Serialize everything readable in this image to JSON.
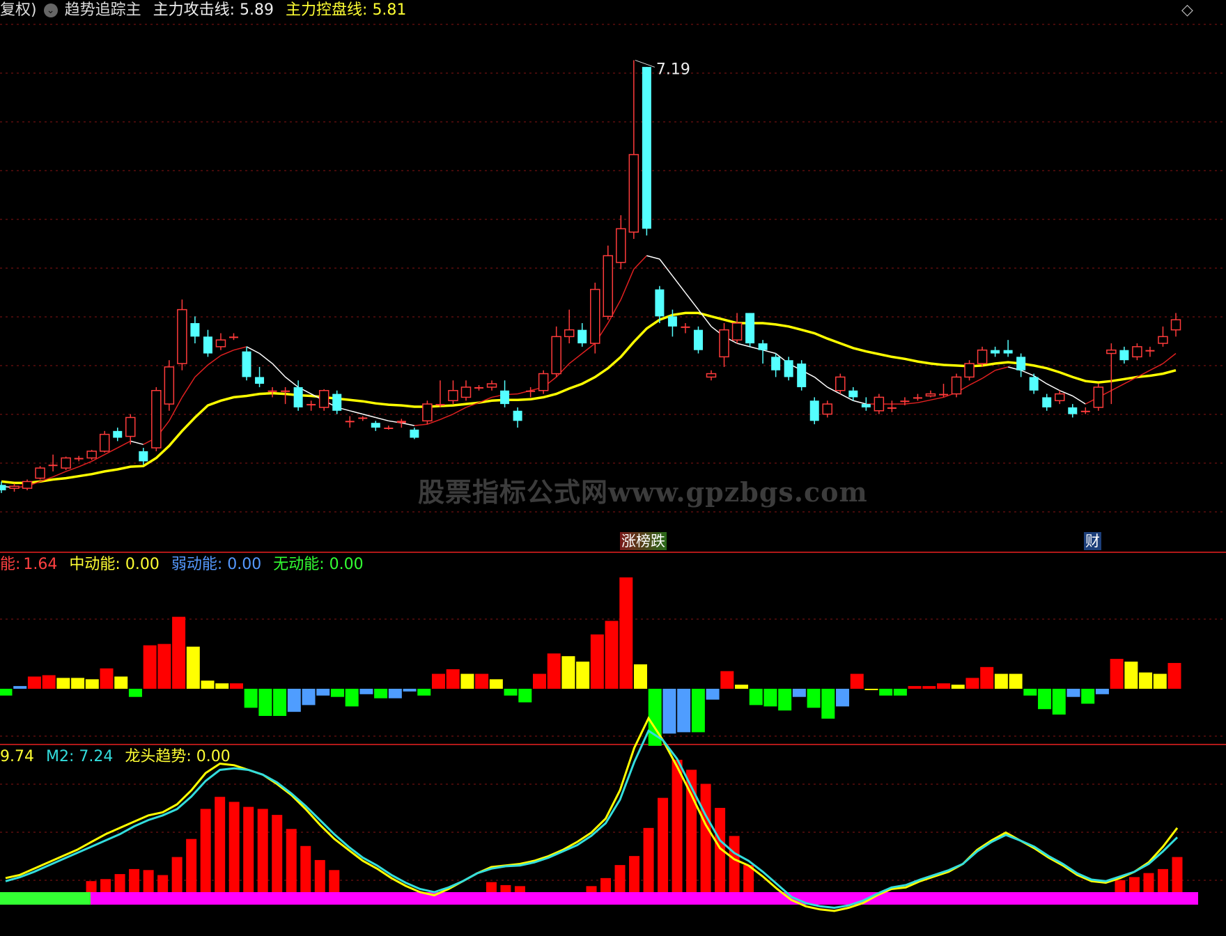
{
  "header_main": {
    "prefix": "复权)",
    "indicator": "趋势追踪主",
    "attack_label": "主力攻击线:",
    "attack_value": "5.89",
    "control_label": "主力控盘线:",
    "control_value": "5.81"
  },
  "header_energy": {
    "strong_label": "能:",
    "strong_value": "1.64",
    "mid_label": "中动能:",
    "mid_value": "0.00",
    "weak_label": "弱动能:",
    "weak_value": "0.00",
    "none_label": "无动能:",
    "none_value": "0.00"
  },
  "header_trend": {
    "m1_value": "9.74",
    "m2_label": "M2:",
    "m2_value": "7.24",
    "dragon_label": "龙头趋势:",
    "dragon_value": "0.00"
  },
  "peak_label": "7.19",
  "badges": {
    "limit": "涨榜跌",
    "finance": "财"
  },
  "watermark": "股票指标公式网www.gpzbgs.com",
  "icons": {
    "expand": "diamond-icon",
    "menu": "circle-chevron-icon"
  },
  "colors": {
    "up": "#ff3b3b",
    "down": "#54ffff",
    "ma_fast": "#ffffff",
    "ma_slow": "#ffff00",
    "red": "#ff0000",
    "yellow": "#ffff00",
    "green": "#00ff00",
    "blue": "#4f9dff",
    "magenta": "#ff00ff",
    "cyan": "#33dddd"
  },
  "chart_data": {
    "type": "candlestick",
    "candles": [
      [
        4.9,
        4.82,
        4.95,
        4.78
      ],
      [
        4.85,
        4.88,
        4.92,
        4.8
      ],
      [
        4.85,
        4.95,
        4.98,
        4.82
      ],
      [
        5.0,
        5.15,
        5.18,
        4.98
      ],
      [
        5.2,
        5.2,
        5.35,
        5.1
      ],
      [
        5.15,
        5.3,
        5.32,
        5.12
      ],
      [
        5.28,
        5.3,
        5.33,
        5.25
      ],
      [
        5.3,
        5.4,
        5.42,
        5.27
      ],
      [
        5.4,
        5.65,
        5.7,
        5.38
      ],
      [
        5.7,
        5.6,
        5.75,
        5.55
      ],
      [
        5.62,
        5.9,
        5.95,
        5.5
      ],
      [
        5.4,
        5.25,
        5.45,
        5.2
      ],
      [
        5.45,
        6.3,
        6.35,
        5.4
      ],
      [
        6.1,
        6.65,
        6.75,
        6.0
      ],
      [
        6.7,
        7.5,
        7.65,
        6.6
      ],
      [
        7.3,
        7.1,
        7.4,
        7.0
      ],
      [
        7.1,
        6.85,
        7.2,
        6.8
      ],
      [
        6.95,
        7.05,
        7.15,
        6.9
      ],
      [
        7.1,
        7.1,
        7.15,
        7.05
      ],
      [
        6.88,
        6.5,
        6.95,
        6.45
      ],
      [
        6.5,
        6.4,
        6.65,
        6.35
      ],
      [
        6.3,
        6.3,
        6.35,
        6.2
      ],
      [
        6.3,
        6.3,
        6.35,
        6.1
      ],
      [
        6.35,
        6.05,
        6.45,
        6.0
      ],
      [
        6.1,
        6.1,
        6.15,
        6.0
      ],
      [
        6.05,
        6.3,
        6.32,
        6.0
      ],
      [
        6.25,
        6.0,
        6.3,
        5.95
      ],
      [
        5.85,
        5.85,
        5.92,
        5.75
      ],
      [
        5.88,
        5.9,
        5.92,
        5.85
      ],
      [
        5.82,
        5.75,
        5.85,
        5.7
      ],
      [
        5.75,
        5.75,
        5.78,
        5.72
      ],
      [
        5.82,
        5.85,
        5.88,
        5.75
      ],
      [
        5.72,
        5.6,
        5.75,
        5.58
      ],
      [
        5.85,
        6.1,
        6.15,
        5.8
      ],
      [
        6.1,
        6.1,
        6.45,
        6.05
      ],
      [
        6.15,
        6.3,
        6.45,
        6.1
      ],
      [
        6.2,
        6.35,
        6.45,
        6.15
      ],
      [
        6.35,
        6.35,
        6.38,
        6.3
      ],
      [
        6.35,
        6.4,
        6.45,
        6.3
      ],
      [
        6.3,
        6.1,
        6.45,
        6.05
      ],
      [
        6.0,
        5.85,
        6.05,
        5.75
      ],
      [
        6.3,
        6.3,
        6.35,
        6.2
      ],
      [
        6.3,
        6.55,
        6.6,
        6.25
      ],
      [
        6.55,
        7.1,
        7.25,
        6.5
      ],
      [
        7.1,
        7.2,
        7.5,
        7.0
      ],
      [
        7.2,
        7.0,
        7.3,
        6.95
      ],
      [
        7.0,
        7.8,
        7.9,
        6.85
      ],
      [
        7.4,
        8.3,
        8.45,
        7.35
      ],
      [
        8.2,
        8.7,
        8.9,
        8.1
      ],
      [
        8.65,
        9.8,
        11.2,
        8.55
      ],
      [
        11.1,
        8.7,
        11.1,
        8.6
      ],
      [
        7.8,
        7.4,
        7.85,
        7.3
      ],
      [
        7.4,
        7.25,
        7.5,
        7.1
      ],
      [
        7.25,
        7.25,
        7.3,
        7.15
      ],
      [
        7.2,
        6.9,
        7.25,
        6.85
      ],
      [
        6.5,
        6.55,
        6.6,
        6.45
      ],
      [
        6.8,
        7.2,
        7.3,
        6.65
      ],
      [
        7.05,
        7.3,
        7.45,
        7.0
      ],
      [
        7.45,
        7.0,
        7.45,
        6.95
      ],
      [
        7.0,
        6.9,
        7.05,
        6.7
      ],
      [
        6.8,
        6.6,
        6.85,
        6.5
      ],
      [
        6.75,
        6.5,
        6.8,
        6.45
      ],
      [
        6.7,
        6.35,
        6.75,
        6.3
      ],
      [
        6.15,
        5.85,
        6.2,
        5.8
      ],
      [
        5.95,
        6.1,
        6.15,
        5.9
      ],
      [
        6.3,
        6.5,
        6.55,
        6.25
      ],
      [
        6.3,
        6.2,
        6.35,
        6.15
      ],
      [
        6.1,
        6.05,
        6.2,
        6.0
      ],
      [
        6.0,
        6.2,
        6.25,
        5.95
      ],
      [
        6.05,
        6.05,
        6.15,
        5.98
      ],
      [
        6.15,
        6.15,
        6.2,
        6.08
      ],
      [
        6.2,
        6.2,
        6.25,
        6.15
      ],
      [
        6.22,
        6.25,
        6.3,
        6.2
      ],
      [
        6.25,
        6.25,
        6.4,
        6.2
      ],
      [
        6.25,
        6.5,
        6.55,
        6.2
      ],
      [
        6.5,
        6.7,
        6.75,
        6.45
      ],
      [
        6.7,
        6.9,
        6.95,
        6.65
      ],
      [
        6.9,
        6.85,
        6.95,
        6.8
      ],
      [
        6.9,
        6.85,
        7.05,
        6.8
      ],
      [
        6.8,
        6.6,
        6.85,
        6.5
      ],
      [
        6.5,
        6.3,
        6.55,
        6.25
      ],
      [
        6.2,
        6.05,
        6.25,
        6.0
      ],
      [
        6.15,
        6.25,
        6.3,
        6.1
      ],
      [
        6.05,
        5.95,
        6.1,
        5.9
      ],
      [
        6.0,
        6.0,
        6.05,
        5.95
      ],
      [
        6.05,
        6.35,
        6.4,
        6.0
      ],
      [
        6.85,
        6.9,
        7.0,
        6.1
      ],
      [
        6.9,
        6.75,
        6.95,
        6.7
      ],
      [
        6.8,
        6.95,
        7.0,
        6.75
      ],
      [
        6.9,
        6.9,
        6.95,
        6.8
      ],
      [
        7.0,
        7.1,
        7.25,
        6.95
      ],
      [
        7.2,
        7.35,
        7.45,
        7.1
      ]
    ],
    "ma_fast": [
      4.88,
      4.86,
      4.88,
      4.95,
      5.02,
      5.1,
      5.17,
      5.25,
      5.35,
      5.45,
      5.55,
      5.5,
      5.6,
      5.85,
      6.2,
      6.5,
      6.68,
      6.82,
      6.9,
      6.95,
      6.85,
      6.7,
      6.5,
      6.35,
      6.25,
      6.15,
      6.05,
      6.0,
      5.95,
      5.9,
      5.85,
      5.82,
      5.78,
      5.8,
      5.87,
      5.95,
      6.05,
      6.12,
      6.2,
      6.24,
      6.25,
      6.3,
      6.35,
      6.5,
      6.7,
      6.85,
      7.0,
      7.3,
      7.65,
      8.1,
      8.3,
      8.25,
      8.0,
      7.75,
      7.5,
      7.25,
      7.1,
      7.0,
      6.95,
      6.9,
      6.85,
      6.7,
      6.6,
      6.5,
      6.35,
      6.25,
      6.15,
      6.1,
      6.1,
      6.1,
      6.1,
      6.12,
      6.16,
      6.2,
      6.27,
      6.38,
      6.48,
      6.6,
      6.65,
      6.6,
      6.52,
      6.4,
      6.3,
      6.22,
      6.1,
      6.2,
      6.3,
      6.4,
      6.5,
      6.6,
      6.7,
      6.85
    ],
    "ma_slow": [
      4.95,
      4.93,
      4.93,
      4.95,
      4.98,
      5.0,
      5.03,
      5.06,
      5.1,
      5.13,
      5.17,
      5.18,
      5.3,
      5.48,
      5.7,
      5.9,
      6.08,
      6.15,
      6.2,
      6.22,
      6.25,
      6.26,
      6.25,
      6.23,
      6.22,
      6.2,
      6.18,
      6.16,
      6.14,
      6.11,
      6.09,
      6.08,
      6.06,
      6.06,
      6.07,
      6.08,
      6.1,
      6.12,
      6.15,
      6.16,
      6.16,
      6.17,
      6.2,
      6.25,
      6.33,
      6.4,
      6.5,
      6.63,
      6.8,
      7.02,
      7.22,
      7.35,
      7.42,
      7.45,
      7.45,
      7.4,
      7.35,
      7.3,
      7.3,
      7.3,
      7.28,
      7.25,
      7.2,
      7.15,
      7.07,
      7.0,
      6.93,
      6.88,
      6.84,
      6.8,
      6.77,
      6.73,
      6.7,
      6.68,
      6.67,
      6.66,
      6.67,
      6.7,
      6.72,
      6.7,
      6.67,
      6.63,
      6.57,
      6.5,
      6.44,
      6.42,
      6.44,
      6.47,
      6.5,
      6.52,
      6.55,
      6.6
    ],
    "energy": [
      [
        -0.25,
        "g"
      ],
      [
        0.1,
        "b"
      ],
      [
        0.45,
        "r"
      ],
      [
        0.5,
        "r"
      ],
      [
        0.4,
        "y"
      ],
      [
        0.4,
        "y"
      ],
      [
        0.35,
        "y"
      ],
      [
        0.75,
        "r"
      ],
      [
        0.45,
        "y"
      ],
      [
        -0.3,
        "g"
      ],
      [
        1.6,
        "r"
      ],
      [
        1.65,
        "r"
      ],
      [
        2.65,
        "r"
      ],
      [
        1.55,
        "y"
      ],
      [
        0.3,
        "y"
      ],
      [
        0.2,
        "y"
      ],
      [
        0.2,
        "r"
      ],
      [
        -0.7,
        "g"
      ],
      [
        -1.0,
        "g"
      ],
      [
        -1.0,
        "g"
      ],
      [
        -0.85,
        "b"
      ],
      [
        -0.6,
        "b"
      ],
      [
        -0.25,
        "b"
      ],
      [
        -0.3,
        "g"
      ],
      [
        -0.65,
        "g"
      ],
      [
        -0.2,
        "b"
      ],
      [
        -0.35,
        "g"
      ],
      [
        -0.35,
        "b"
      ],
      [
        -0.1,
        "b"
      ],
      [
        -0.25,
        "g"
      ],
      [
        0.55,
        "r"
      ],
      [
        0.72,
        "r"
      ],
      [
        0.55,
        "y"
      ],
      [
        0.55,
        "r"
      ],
      [
        0.35,
        "y"
      ],
      [
        -0.25,
        "g"
      ],
      [
        -0.5,
        "g"
      ],
      [
        0.55,
        "r"
      ],
      [
        1.3,
        "r"
      ],
      [
        1.2,
        "y"
      ],
      [
        1.0,
        "y"
      ],
      [
        2.0,
        "r"
      ],
      [
        2.5,
        "r"
      ],
      [
        4.1,
        "r"
      ],
      [
        0.9,
        "y"
      ],
      [
        -2.1,
        "g"
      ],
      [
        -1.65,
        "b"
      ],
      [
        -1.6,
        "b"
      ],
      [
        -1.6,
        "g"
      ],
      [
        -0.4,
        "b"
      ],
      [
        0.65,
        "r"
      ],
      [
        0.15,
        "y"
      ],
      [
        -0.6,
        "g"
      ],
      [
        -0.65,
        "g"
      ],
      [
        -0.8,
        "g"
      ],
      [
        -0.3,
        "b"
      ],
      [
        -0.7,
        "g"
      ],
      [
        -1.1,
        "g"
      ],
      [
        -0.65,
        "b"
      ],
      [
        0.55,
        "r"
      ],
      [
        -0.05,
        "y"
      ],
      [
        -0.25,
        "g"
      ],
      [
        -0.25,
        "g"
      ],
      [
        0.1,
        "r"
      ],
      [
        0.1,
        "r"
      ],
      [
        0.2,
        "r"
      ],
      [
        0.15,
        "y"
      ],
      [
        0.4,
        "r"
      ],
      [
        0.8,
        "r"
      ],
      [
        0.55,
        "y"
      ],
      [
        0.55,
        "y"
      ],
      [
        -0.25,
        "g"
      ],
      [
        -0.75,
        "g"
      ],
      [
        -0.95,
        "g"
      ],
      [
        -0.3,
        "b"
      ],
      [
        -0.55,
        "g"
      ],
      [
        -0.2,
        "b"
      ],
      [
        1.1,
        "r"
      ],
      [
        1.0,
        "y"
      ],
      [
        0.6,
        "y"
      ],
      [
        0.55,
        "y"
      ],
      [
        0.95,
        "r"
      ]
    ],
    "dragon_bars": [
      0,
      0,
      0,
      0,
      0,
      0,
      1.1,
      1.3,
      1.8,
      2.3,
      2.2,
      1.7,
      3.5,
      5.3,
      8.3,
      9.5,
      9.0,
      8.5,
      8.3,
      7.7,
      6.3,
      4.6,
      3.2,
      2.2,
      0,
      0,
      0,
      0,
      0,
      0,
      0,
      0,
      0,
      0,
      0,
      0,
      0,
      0,
      1.0,
      0.7,
      0.6,
      0,
      0,
      0,
      0.6,
      1.4,
      2.7,
      3.6,
      6.4,
      9.4,
      13.2,
      12.2,
      10.8,
      8.4,
      5.6,
      2.7
    ],
    "m1": [
      3.2,
      3.4,
      3.8,
      4.2,
      4.6,
      5.0,
      5.5,
      6.0,
      6.4,
      6.8,
      7.2,
      7.4,
      7.9,
      8.8,
      9.9,
      10.5,
      10.4,
      10.1,
      9.8,
      9.2,
      8.5,
      7.6,
      6.6,
      5.7,
      5.0,
      4.3,
      3.8,
      3.2,
      2.7,
      2.3,
      2.1,
      2.5,
      3.0,
      3.5,
      3.9,
      4.0,
      4.1,
      4.3,
      4.6,
      5.0,
      5.5,
      6.1,
      7.0,
      8.8,
      11.5,
      13.4,
      12.0,
      10.3,
      8.5,
      6.6,
      5.1,
      4.4,
      4.0,
      3.3,
      2.5,
      1.8,
      1.4,
      1.2,
      1.1,
      1.3,
      1.6,
      2.1,
      2.5,
      2.6,
      3.0,
      3.3,
      3.6,
      4.1,
      5.0,
      5.6,
      6.1,
      5.6,
      5.1,
      4.5,
      4.0,
      3.4,
      3.0,
      2.9,
      3.2,
      3.6,
      4.2,
      5.2,
      6.4
    ],
    "m2": [
      3.0,
      3.25,
      3.6,
      4.0,
      4.4,
      4.8,
      5.2,
      5.6,
      6.0,
      6.5,
      6.9,
      7.2,
      7.6,
      8.4,
      9.4,
      10.1,
      10.2,
      10.1,
      9.8,
      9.3,
      8.6,
      7.8,
      6.9,
      6.0,
      5.2,
      4.5,
      4.0,
      3.4,
      2.9,
      2.5,
      2.3,
      2.6,
      3.0,
      3.5,
      3.8,
      3.95,
      4.0,
      4.2,
      4.5,
      4.9,
      5.3,
      5.9,
      6.7,
      8.2,
      10.6,
      12.6,
      12.0,
      10.8,
      9.0,
      7.2,
      5.6,
      4.8,
      4.3,
      3.6,
      2.8,
      2.0,
      1.6,
      1.4,
      1.3,
      1.45,
      1.75,
      2.2,
      2.6,
      2.75,
      3.1,
      3.4,
      3.7,
      4.1,
      4.9,
      5.5,
      5.95,
      5.6,
      5.2,
      4.6,
      4.1,
      3.5,
      3.1,
      3.0,
      3.3,
      3.6,
      4.1,
      4.9,
      5.8
    ]
  }
}
